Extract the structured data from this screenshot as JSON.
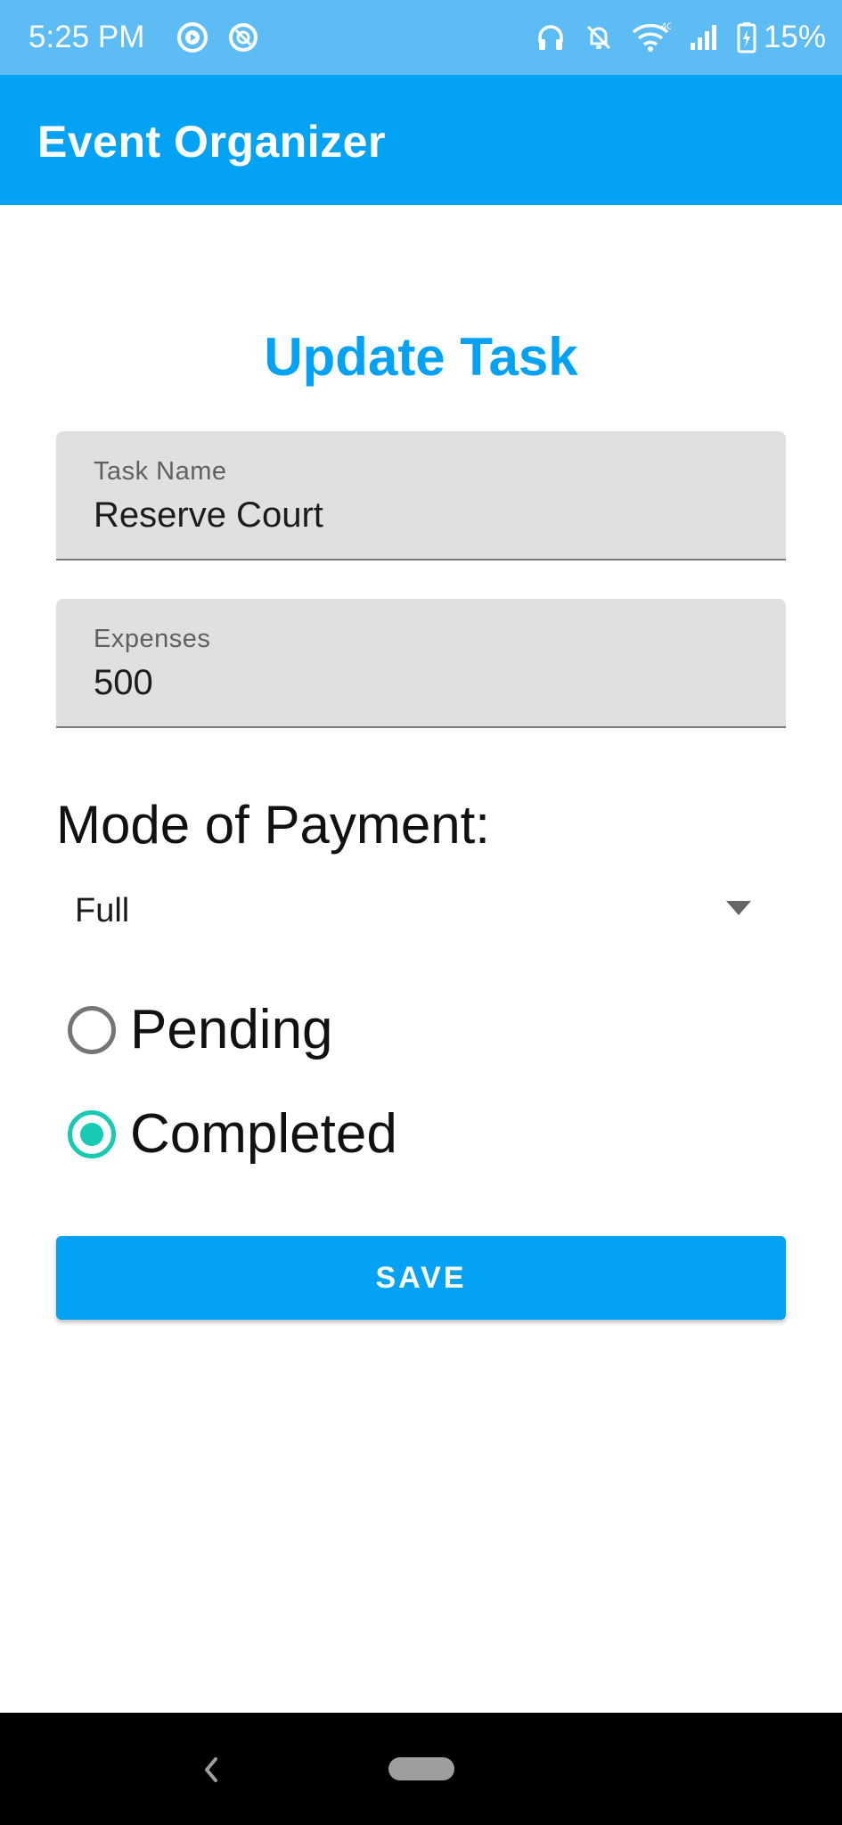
{
  "status_bar": {
    "time": "5:25 PM",
    "left_icons": [
      "play-circle-icon",
      "sync-icon"
    ],
    "right_icons": [
      "headphones-icon",
      "bell-off-icon",
      "wifi-icon",
      "cellular-signal-icon",
      "battery-charging-icon"
    ],
    "network_type": "4G",
    "battery_percent": "15%"
  },
  "app_bar": {
    "title": "Event Organizer",
    "color": "#03a2f5"
  },
  "form": {
    "heading": "Update Task",
    "task_name": {
      "label": "Task Name",
      "value": "Reserve Court"
    },
    "expenses": {
      "label": "Expenses",
      "value": "500"
    },
    "payment": {
      "label": "Mode of Payment:",
      "selected": "Full"
    },
    "status_options": [
      {
        "label": "Pending",
        "checked": false
      },
      {
        "label": "Completed",
        "checked": true
      }
    ],
    "save_label": "SAVE"
  },
  "colors": {
    "accent": "#03a2f5",
    "status_bar": "#5ebcf4",
    "radio_checked": "#18c9b3"
  },
  "nav_bar": {
    "icons": [
      "back-chevron-icon",
      "home-pill-icon"
    ]
  }
}
